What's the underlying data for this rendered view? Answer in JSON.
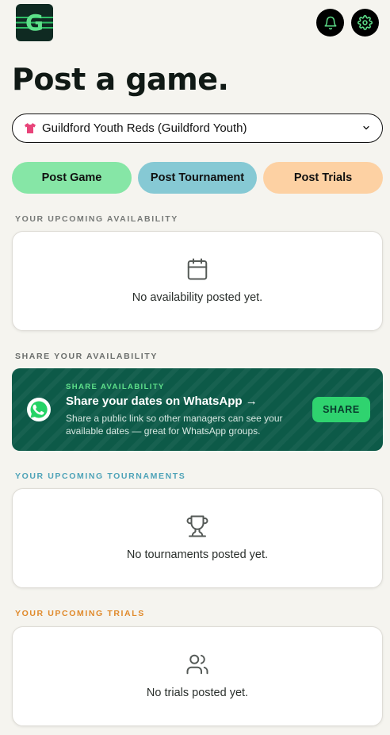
{
  "header": {
    "logo_letter": "G",
    "logo_icon": "stripes-g-logo",
    "notifications_icon": "bell-icon",
    "settings_icon": "gear-icon"
  },
  "page": {
    "title": "Post a game."
  },
  "team_select": {
    "selected": "Guildford Youth Reds (Guildford Youth)",
    "shirt_color": "#e8447a",
    "icon": "chevron-down-icon"
  },
  "actions": {
    "post_game": "Post Game",
    "post_tournament": "Post Tournament",
    "post_trials": "Post Trials"
  },
  "sections": {
    "availability": {
      "label": "Your upcoming availability",
      "empty": "No availability posted yet.",
      "icon": "calendar-icon"
    },
    "share": {
      "label": "Share your availability",
      "kicker": "Share availability",
      "headline": "Share your dates on WhatsApp →",
      "description": "Share a public link so other managers can see your available dates — great for WhatsApp groups.",
      "button": "SHARE",
      "icon": "whatsapp-icon"
    },
    "tournaments": {
      "label": "Your upcoming tournaments",
      "empty": "No tournaments posted yet.",
      "icon": "trophy-icon"
    },
    "trials": {
      "label": "Your upcoming trials",
      "empty": "No trials posted yet.",
      "icon": "users-icon"
    }
  },
  "colors": {
    "accent_green": "#86e6a6",
    "accent_blue": "#86c9d4",
    "accent_orange": "#fdd1a3",
    "share_bg": "#0d5a48",
    "share_button": "#2fd36f",
    "tournament_label": "#4ea3b8",
    "trials_label": "#e08a2c"
  }
}
